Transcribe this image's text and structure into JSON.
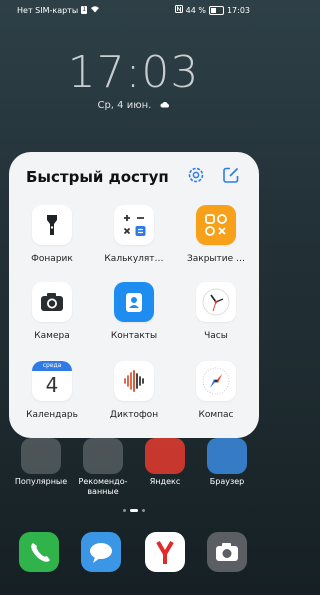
{
  "status_bar": {
    "carrier": "Нет SIM-карты",
    "sim_badge": "1",
    "battery_pct": "44 %",
    "time": "17:03"
  },
  "lockscreen": {
    "clock": "17:03",
    "date": "Ср, 4 июн."
  },
  "quick_access": {
    "title": "Быстрый доступ",
    "items": [
      {
        "label": "Фонарик",
        "icon": "flashlight-icon"
      },
      {
        "label": "Калькулят…",
        "icon": "calculator-icon"
      },
      {
        "label": "Закрытие …",
        "icon": "close-all-icon"
      },
      {
        "label": "Камера",
        "icon": "camera-icon"
      },
      {
        "label": "Контакты",
        "icon": "contacts-icon"
      },
      {
        "label": "Часы",
        "icon": "clock-icon"
      },
      {
        "label": "Календарь",
        "icon": "calendar-icon",
        "day_name": "среда",
        "day_num": "4"
      },
      {
        "label": "Диктофон",
        "icon": "recorder-icon"
      },
      {
        "label": "Компас",
        "icon": "compass-icon"
      }
    ]
  },
  "home": {
    "apps": [
      {
        "label": "Популярные"
      },
      {
        "label": "Рекомендо-ванные"
      },
      {
        "label": "Яндекс"
      },
      {
        "label": "Браузер"
      }
    ]
  },
  "colors": {
    "accent": "#2f7be6",
    "panel_bg": "#f3f4f6",
    "close_all": "#f7a11b",
    "contacts": "#1f8cf0"
  }
}
